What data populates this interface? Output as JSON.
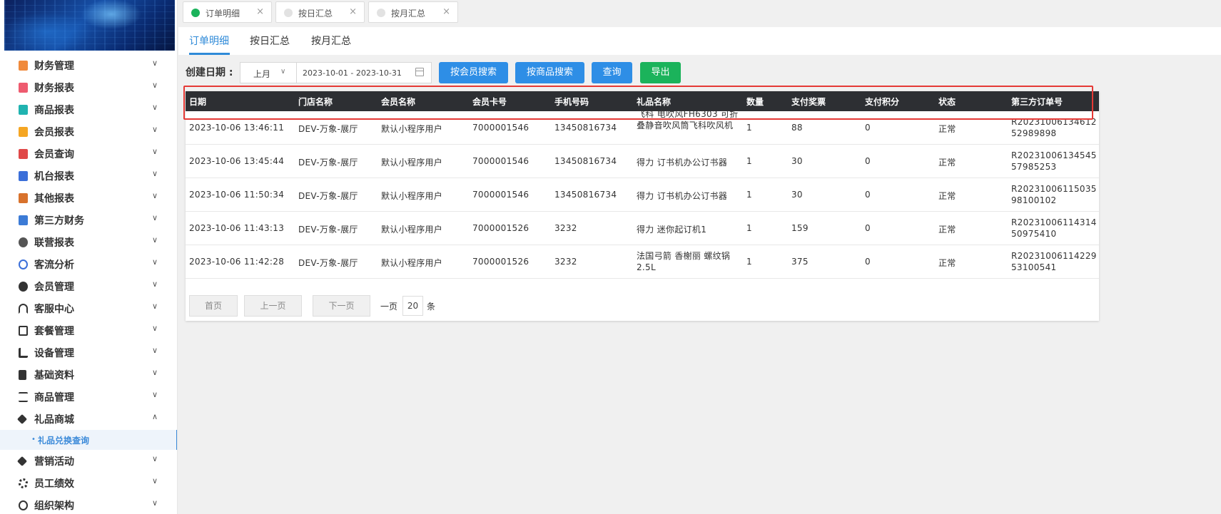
{
  "sidebar": {
    "menu": [
      {
        "label": "财务管理",
        "icon": "finance-icon",
        "color": "#f08a3c"
      },
      {
        "label": "财务报表",
        "icon": "report-icon",
        "color": "#ee5b6f"
      },
      {
        "label": "商品报表",
        "icon": "goods-report-icon",
        "color": "#20b3b0"
      },
      {
        "label": "会员报表",
        "icon": "member-report-icon",
        "color": "#f5a623"
      },
      {
        "label": "会员查询",
        "icon": "member-search-icon",
        "color": "#e04848"
      },
      {
        "label": "机台报表",
        "icon": "machine-icon",
        "color": "#3b6fd9"
      },
      {
        "label": "其他报表",
        "icon": "layers-icon",
        "color": "#d8722c"
      },
      {
        "label": "第三方财务",
        "icon": "calculator-icon",
        "color": "#3c7bd6"
      },
      {
        "label": "联营报表",
        "icon": "people-icon",
        "color": "#555555"
      },
      {
        "label": "客流分析",
        "icon": "target-icon",
        "color": "#3b6fd9"
      },
      {
        "label": "会员管理",
        "icon": "user-icon",
        "color": "#333333"
      },
      {
        "label": "客服中心",
        "icon": "headset-icon",
        "color": "#333333"
      },
      {
        "label": "套餐管理",
        "icon": "edit-icon",
        "color": "#333333"
      },
      {
        "label": "设备管理",
        "icon": "wrench-icon",
        "color": "#333333"
      },
      {
        "label": "基础资料",
        "icon": "file-icon",
        "color": "#333333"
      },
      {
        "label": "商品管理",
        "icon": "exchange-icon",
        "color": "#333333"
      },
      {
        "label": "礼品商城",
        "icon": "tag-icon",
        "color": "#333333"
      },
      {
        "label": "营销活动",
        "icon": "tag-icon",
        "color": "#333333"
      },
      {
        "label": "员工绩效",
        "icon": "gear-icon",
        "color": "#333333"
      },
      {
        "label": "组织架构",
        "icon": "org-icon",
        "color": "#333333"
      }
    ],
    "submenu_label": "礼品兑换查询"
  },
  "top_tabs": [
    {
      "label": "订单明细",
      "active": true
    },
    {
      "label": "按日汇总",
      "active": false
    },
    {
      "label": "按月汇总",
      "active": false
    }
  ],
  "sub_tabs": [
    "订单明细",
    "按日汇总",
    "按月汇总"
  ],
  "filter": {
    "date_label": "创建日期 :",
    "period_value": "上月",
    "date_range": "2023-10-01 - 2023-10-31",
    "btn_member_search": "按会员搜索",
    "btn_goods_search": "按商品搜索",
    "btn_query": "查询",
    "btn_export": "导出"
  },
  "table": {
    "columns": [
      "日期",
      "门店名称",
      "会员名称",
      "会员卡号",
      "手机号码",
      "礼品名称",
      "数量",
      "支付奖票",
      "支付积分",
      "状态",
      "第三方订单号"
    ],
    "rows": [
      [
        "2023-10-06 13:46:11",
        "DEV-万象-展厅",
        "默认小程序用户",
        "7000001546",
        "13450816734",
        "飞科 电吹风FH6303 可折叠静音吹风筒飞科吹风机",
        "1",
        "88",
        "0",
        "正常",
        "R20231006134612 52989898"
      ],
      [
        "2023-10-06 13:45:44",
        "DEV-万象-展厅",
        "默认小程序用户",
        "7000001546",
        "13450816734",
        "得力 订书机办公订书器",
        "1",
        "30",
        "0",
        "正常",
        "R20231006134545 57985253"
      ],
      [
        "2023-10-06 11:50:34",
        "DEV-万象-展厅",
        "默认小程序用户",
        "7000001546",
        "13450816734",
        "得力 订书机办公订书器",
        "1",
        "30",
        "0",
        "正常",
        "R20231006115035 98100102"
      ],
      [
        "2023-10-06 11:43:13",
        "DEV-万象-展厅",
        "默认小程序用户",
        "7000001526",
        "3232",
        "得力 迷你起订机1",
        "1",
        "159",
        "0",
        "正常",
        "R20231006114314 50975410"
      ],
      [
        "2023-10-06 11:42:28",
        "DEV-万象-展厅",
        "默认小程序用户",
        "7000001526",
        "3232",
        "法国弓箭 香榭丽 螺纹锅2.5L",
        "1",
        "375",
        "0",
        "正常",
        "R20231006114229 53100541"
      ]
    ]
  },
  "pagination": {
    "first": "首页",
    "prev": "上一页",
    "next": "下一页",
    "per_page_label": "一页",
    "page_size": "20",
    "unit": "条"
  },
  "colors": {
    "accent": "#2e8ad8",
    "button_blue": "#2e8ee6",
    "button_green": "#1bb35b",
    "table_header": "#2d2f33",
    "highlight_box": "#e53935",
    "tab_active_dot": "#1bb35b"
  }
}
